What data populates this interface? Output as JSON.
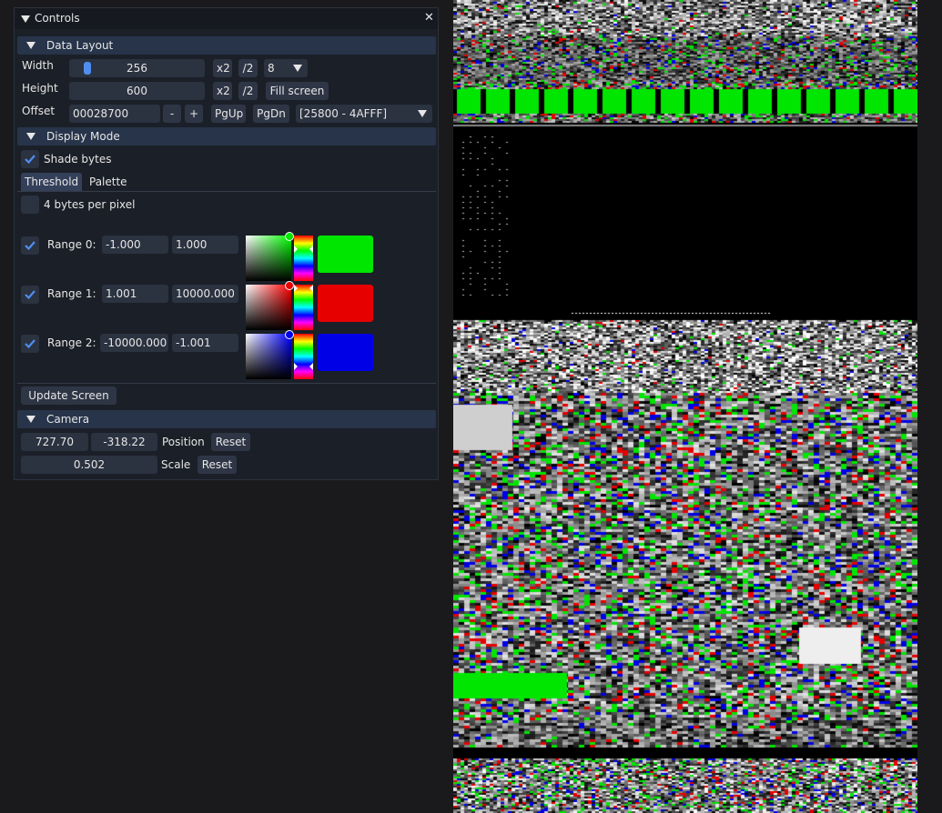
{
  "window": {
    "title": "Controls",
    "close_glyph": "✕"
  },
  "data_layout": {
    "header": "Data Layout",
    "width": {
      "label": "Width",
      "value": "256",
      "slider_fraction": 0.05,
      "x2": "x2",
      "div2": "/2",
      "combo": "8"
    },
    "height": {
      "label": "Height",
      "value": "600",
      "x2": "x2",
      "div2": "/2",
      "fill": "Fill screen"
    },
    "offset": {
      "label": "Offset",
      "value": "00028700",
      "minus": "-",
      "plus": "+",
      "pgup": "PgUp",
      "pgdn": "PgDn",
      "range": "[25800 - 4AFFF]"
    }
  },
  "display_mode": {
    "header": "Display Mode",
    "shade_bytes": {
      "label": "Shade bytes",
      "checked": true
    },
    "tabs": [
      "Threshold",
      "Palette"
    ],
    "active_tab": 0,
    "four_bytes": {
      "label": "4 bytes per pixel",
      "checked": false
    },
    "ranges": [
      {
        "label": "Range 0:",
        "min": "-1.000",
        "max": "1.000",
        "checked": true,
        "color": "#00e600",
        "hue_color": "#00ff00"
      },
      {
        "label": "Range 1:",
        "min": "1.001",
        "max": "10000.000",
        "checked": true,
        "color": "#e60000",
        "hue_color": "#ff0000"
      },
      {
        "label": "Range 2:",
        "min": "-10000.000",
        "max": "-1.001",
        "checked": true,
        "color": "#0000e6",
        "hue_color": "#0000ff"
      }
    ],
    "update_button": "Update Screen"
  },
  "camera": {
    "header": "Camera",
    "x": "727.70",
    "y": "-318.22",
    "position_label": "Position",
    "position_reset": "Reset",
    "scale": "0.502",
    "scale_label": "Scale",
    "scale_reset": "Reset"
  },
  "colors": {
    "accent": "#4f8ef0",
    "header_bg": "#27344a",
    "panel_bg": "#1b1f27",
    "field_bg": "#2b3240"
  }
}
